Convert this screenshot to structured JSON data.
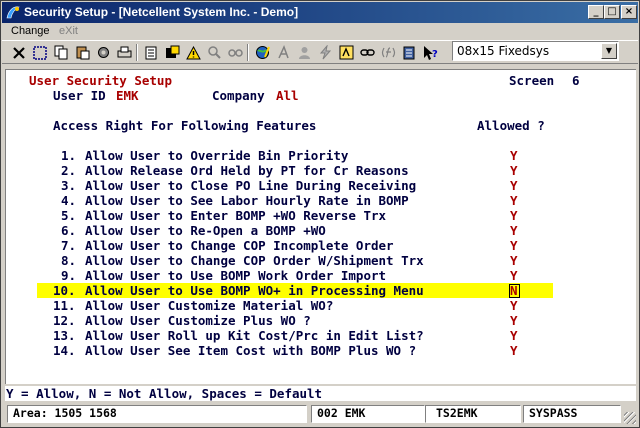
{
  "window": {
    "title": "Security Setup - [Netcellent System Inc. - Demo]",
    "controls": {
      "minimize": "_",
      "maximize": "□",
      "close": "×"
    }
  },
  "menu": [
    {
      "label": "Change",
      "enabled": true
    },
    {
      "label": "eXit",
      "enabled": false
    }
  ],
  "toolbar": {
    "icons": [
      "close-x-icon",
      "select-icon",
      "copy-icon",
      "paste-icon",
      "settings-icon",
      "print-icon",
      "list-icon",
      "export-icon",
      "alert-icon",
      "search-icon",
      "find-icon",
      "globe-icon",
      "font-icon",
      "user-icon",
      "lightning-icon",
      "macro-icon",
      "link-icon",
      "function-icon",
      "notes-icon",
      "help-pointer-icon"
    ],
    "font_select": {
      "value": "08x15 Fixedsys"
    }
  },
  "screen": {
    "heading": "User Security Setup",
    "screen_label": "Screen",
    "screen_number": "6",
    "user_id_label": "User ID",
    "user_id": "EMK",
    "company_label": "Company",
    "company": "All",
    "access_heading": "Access Right For Following Features",
    "allowed_heading": "Allowed ?",
    "features": [
      {
        "num": "1.",
        "label": "Allow User to Override Bin Priority",
        "allowed": "Y"
      },
      {
        "num": "2.",
        "label": "Allow Release Ord Held by PT for Cr Reasons",
        "allowed": "Y"
      },
      {
        "num": "3.",
        "label": "Allow User to Close PO Line During Receiving",
        "allowed": "Y"
      },
      {
        "num": "4.",
        "label": "Allow User to See Labor Hourly Rate in BOMP",
        "allowed": "Y"
      },
      {
        "num": "5.",
        "label": "Allow User to Enter BOMP +WO Reverse Trx",
        "allowed": "Y"
      },
      {
        "num": "6.",
        "label": "Allow User to Re-Open a BOMP +WO",
        "allowed": "Y"
      },
      {
        "num": "7.",
        "label": "Allow User to Change COP Incomplete Order",
        "allowed": "Y"
      },
      {
        "num": "8.",
        "label": "Allow User to Change COP Order W/Shipment Trx",
        "allowed": "Y"
      },
      {
        "num": "9.",
        "label": "Allow User to Use BOMP Work Order Import",
        "allowed": "Y"
      },
      {
        "num": "10.",
        "label": "Allow User to Use BOMP WO+ in Processing Menu",
        "allowed": "N"
      },
      {
        "num": "11.",
        "label": "Allow User Customize Material WO?",
        "allowed": "Y"
      },
      {
        "num": "12.",
        "label": "Allow User Customize Plus WO ?",
        "allowed": "Y"
      },
      {
        "num": "13.",
        "label": "Allow User Roll up Kit Cost/Prc in Edit List?",
        "allowed": "Y"
      },
      {
        "num": "14.",
        "label": "Allow User See Item Cost with BOMP Plus WO ?",
        "allowed": "Y"
      }
    ],
    "hint": "Y = Allow, N = Not Allow, Spaces = Default"
  },
  "status": {
    "area": "Area: 1505 1568",
    "user": "002 EMK",
    "terminal": "TS2EMK",
    "program": "SYSPASS"
  },
  "colors": {
    "highlight": "#ffff00",
    "accent": "#a80000",
    "title_bg": "#0a246a"
  }
}
